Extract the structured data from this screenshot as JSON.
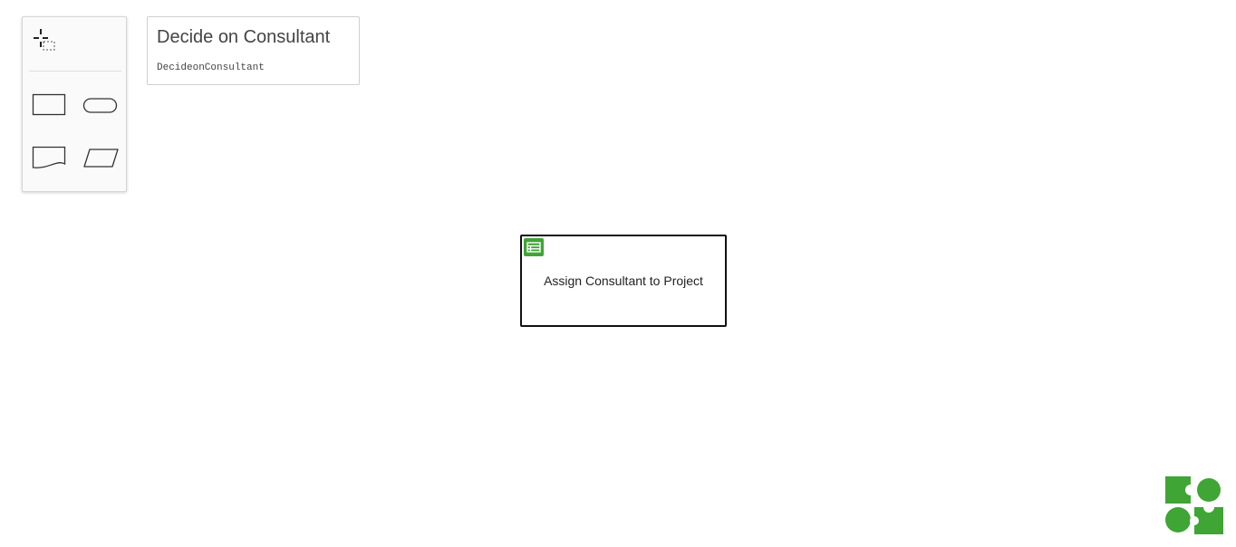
{
  "palette": {
    "tools": [
      {
        "name": "lasso-tool",
        "icon": "lasso-icon"
      },
      {
        "name": "task-tool",
        "icon": "rectangle-icon"
      },
      {
        "name": "subprocess-tool",
        "icon": "rounded-rectangle-icon"
      },
      {
        "name": "document-tool",
        "icon": "document-icon"
      },
      {
        "name": "data-tool",
        "icon": "parallelogram-icon"
      }
    ]
  },
  "diagram": {
    "title": "Decide on Consultant",
    "id": "DecideonConsultant"
  },
  "task": {
    "label": "Assign Consultant to Project",
    "icon": "user-task-icon"
  },
  "colors": {
    "accent": "#3fa535",
    "border": "#111111",
    "panel": "#fafafa"
  },
  "logo": {
    "icon": "brand-logo"
  }
}
